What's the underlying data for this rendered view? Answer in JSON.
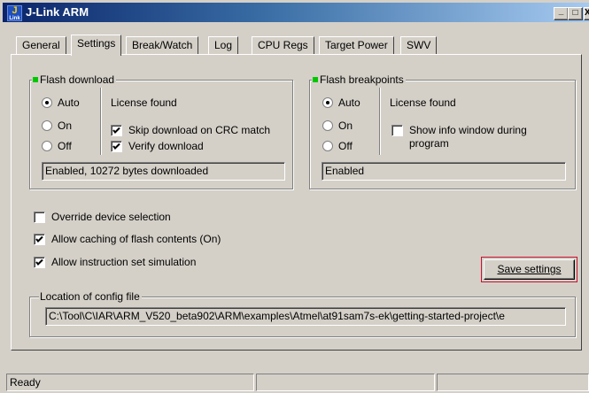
{
  "window": {
    "title": "J-Link ARM",
    "icon": {
      "top": "J",
      "bottom": "Link"
    },
    "controls": {
      "minimize": "_",
      "maximize": "□",
      "close": "X"
    }
  },
  "tabs": [
    {
      "label": "General",
      "active": false
    },
    {
      "label": "Settings",
      "active": true
    },
    {
      "label": "Break/Watch",
      "active": false
    },
    {
      "label": "Log",
      "active": false
    },
    {
      "label": "CPU Regs",
      "active": false
    },
    {
      "label": "Target Power",
      "active": false
    },
    {
      "label": "SWV",
      "active": false
    }
  ],
  "flash_download": {
    "title": "Flash download",
    "options": [
      {
        "label": "Auto",
        "selected": true
      },
      {
        "label": "On",
        "selected": false
      },
      {
        "label": "Off",
        "selected": false
      }
    ],
    "license": "License found",
    "checks": [
      {
        "label": "Skip download on CRC match",
        "checked": true
      },
      {
        "label": "Verify download",
        "checked": true
      }
    ],
    "status": "Enabled, 10272 bytes downloaded"
  },
  "flash_breakpoints": {
    "title": "Flash breakpoints",
    "options": [
      {
        "label": "Auto",
        "selected": true
      },
      {
        "label": "On",
        "selected": false
      },
      {
        "label": "Off",
        "selected": false
      }
    ],
    "license": "License found",
    "checks": [
      {
        "label": "Show info window during",
        "label2": "program",
        "checked": false
      }
    ],
    "status": "Enabled"
  },
  "options": [
    {
      "label": "Override device selection",
      "checked": false
    },
    {
      "label": "Allow caching of flash contents (On)",
      "checked": true
    },
    {
      "label": "Allow instruction set simulation",
      "checked": true
    }
  ],
  "save_button": "Save settings",
  "config_file": {
    "title": "Location of config file",
    "path": "C:\\Tool\\C\\IAR\\ARM_V520_beta902\\ARM\\examples\\Atmel\\at91sam7s-ek\\getting-started-project\\e"
  },
  "status_bar": {
    "text": "Ready"
  },
  "colors": {
    "face": "#d4d0c8",
    "title_start": "#0a246a",
    "title_end": "#a6caf0",
    "indicator": "#00c800",
    "focus_border": "#c8102e"
  }
}
